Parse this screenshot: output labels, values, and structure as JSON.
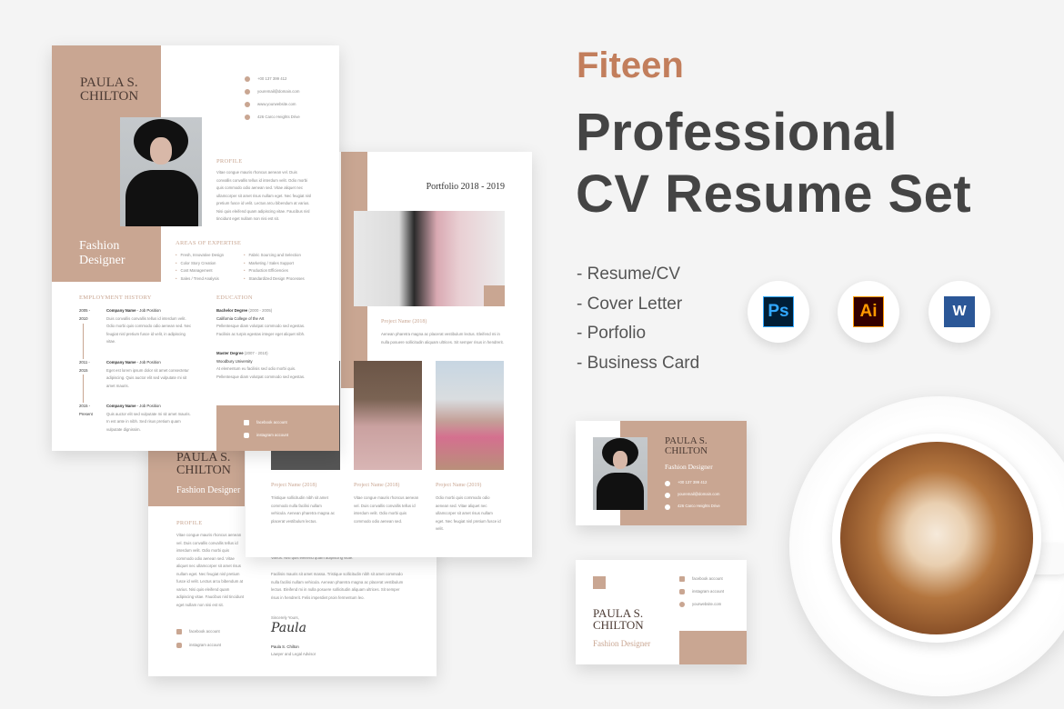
{
  "brand": "Fiteen",
  "headline": {
    "line1": "Professional",
    "line2": "CV Resume Set"
  },
  "features": [
    "- Resume/CV",
    "- Cover Letter",
    "- Porfolio",
    "- Business Card"
  ],
  "app_icons": [
    {
      "name": "photoshop-icon",
      "label": "Ps",
      "color": "#31a8ff",
      "bg": "#001e36"
    },
    {
      "name": "illustrator-icon",
      "label": "Ai",
      "color": "#ff9a00",
      "bg": "#330000"
    },
    {
      "name": "word-icon",
      "label": "W",
      "color": "#ffffff",
      "bg": "#2b5797"
    }
  ],
  "colors": {
    "accent": "#c9a692",
    "brand": "#c27e5c",
    "title": "#444444"
  },
  "person": {
    "first": "PAULA S.",
    "last": "CHILTON",
    "role_l1": "Fashion",
    "role_l2": "Designer",
    "role": "Fashion Designer"
  },
  "contact": {
    "phone": "+00 137 399 412",
    "email": "youremail@domain.com",
    "web": "www.yourwebsite.com",
    "address": "426 Carco Heights Drive",
    "facebook": "facebook account",
    "instagram": "instagram account",
    "web_short": "yourwebsite.com"
  },
  "resume": {
    "profile_title": "PROFILE",
    "profile_text": "Vitae congue mauris rhoncus aenean vel. Duis convallis convallis tellus id interdum velit. Odio morbi quis commodo odio aenean sed. Vitae aliquet nec ullamcorper sit amet risus nullam eget. Nec feugiat nisl pretium fusce id velit. Lectus arcu bibendum at varius. Nisi quis eleifend quam adipiscing vitae. Faucibus nisl tincidunt eget nullam non nisi est sit.",
    "expertise_title": "AREAS OF EXPERTISE",
    "expertise": [
      "Fresh, Innovative Design",
      "Color Story Creation",
      "Cost Management",
      "Sales / Trend Analysis",
      "Fabric Sourcing and Selection",
      "Marketing / Sales Support",
      "Production Efficiencies",
      "Standardized Design Processes"
    ],
    "employment_title": "EMPLOYMENT HISTORY",
    "jobs": [
      {
        "y1": "2005 -",
        "y2": "2010",
        "title": "Company Name",
        "pos": " - Job Position",
        "text": "Duis convallis convallis tellus id interdum velit. Odio morbi quis commodo odio aenean sed. Nec feugiat nisl pretium fusce id velit, in adipiscing vitae."
      },
      {
        "y1": "2011 -",
        "y2": "2015",
        "title": "Company Name",
        "pos": " - Job Position",
        "text": "Eget est lorem ipsum dolor sit amet consectetur adipiscing. Quis auctor elit sed vulputate mi sit amet mauris."
      },
      {
        "y1": "2015 -",
        "y2": "Present",
        "title": "Company Name",
        "pos": " - Job Position",
        "text": "Quis auctor elit sed vulputate mi sit amet mauris. In est ante in nibh. Sed risus pretium quam vulputate dignissim."
      }
    ],
    "education_title": "EDUCATION",
    "education": [
      {
        "degree": "Bachelor Degree",
        "years": " (2000 - 2005)",
        "school": "California College of the Art",
        "text": "Pellentesque diam volutpat commodo sed egestas. Facilisis ac turpis egestas integer eget aliquet nibh."
      },
      {
        "degree": "Master Degree",
        "years": " (2007 - 2010)",
        "school": "Woodbury University",
        "text": "At elementum eu facilisis sed odio morbi quis. Pellentesque diam volutpat commodo sed egestas."
      }
    ]
  },
  "portfolio": {
    "title": "Portfolio 2018 - 2019",
    "projects": [
      {
        "name": "Project Name (2018)",
        "text": "Aenean pharetra magna ac placerat vestibulum lectus. Eleifend mi in nulla posuere sollicitudin aliquam ultrices. Sit semper risus in hendrerit."
      },
      {
        "name": "Project Name (2018)",
        "text": "Tristique sollicitudin nibh sit amet commodo nulla facilisi nullam vehicula. Aenean pharetra magna ac placerat vestibulum lectus."
      },
      {
        "name": "Project Name (2018)",
        "text": "Vitae congue mauris rhoncus aenean vel. Duis convallis convallis tellus id interdum velit. Odio morbi quis commodo odio aenean sed."
      },
      {
        "name": "Project Name (2019)",
        "text": "Odio morbi quis commodo odio aenean sed. Vitae aliquet nec ullamcorper sit amet risus nullam eget. Nec feugiat nisl pretium fusce id velit."
      }
    ]
  },
  "cover": {
    "profile_title": "PROFILE",
    "profile_text": "Vitae congue mauris rhoncus aenean vel. Duis convallis convallis tellus id interdum velit. Odio morbi quis commodo odio aenean sed. Vitae aliquet nec ullamcorper sit amet risus nullam eget. Nec feugiat nisl pretium fusce id velit. Lectus arcu bibendum at varius. Nisi quis eleifend quam adipiscing vitae. Faucibus nisl tincidunt eget nullam non nisi est sit.",
    "para1": "Varius. Nisi quis eleifend quam adipiscing vitae.",
    "para2": "Facilisis mauris sit amet massa. Tristique sollicitudin nibh sit amet commodo nulla facilisi nullam vehicula. Aenean pharetra magna ac placerat vestibulum lectus. Eleifend mi in nulla posuere sollicitudin aliquam ultrices. Sit semper risus in hendrerit. Felis imperdiet proin fermentum leo.",
    "closing": "Sincerely Yours,",
    "signature": "Paula",
    "signer": "Paula S. Chilton",
    "signer_title": "Lawyer and Legal Advisor"
  }
}
